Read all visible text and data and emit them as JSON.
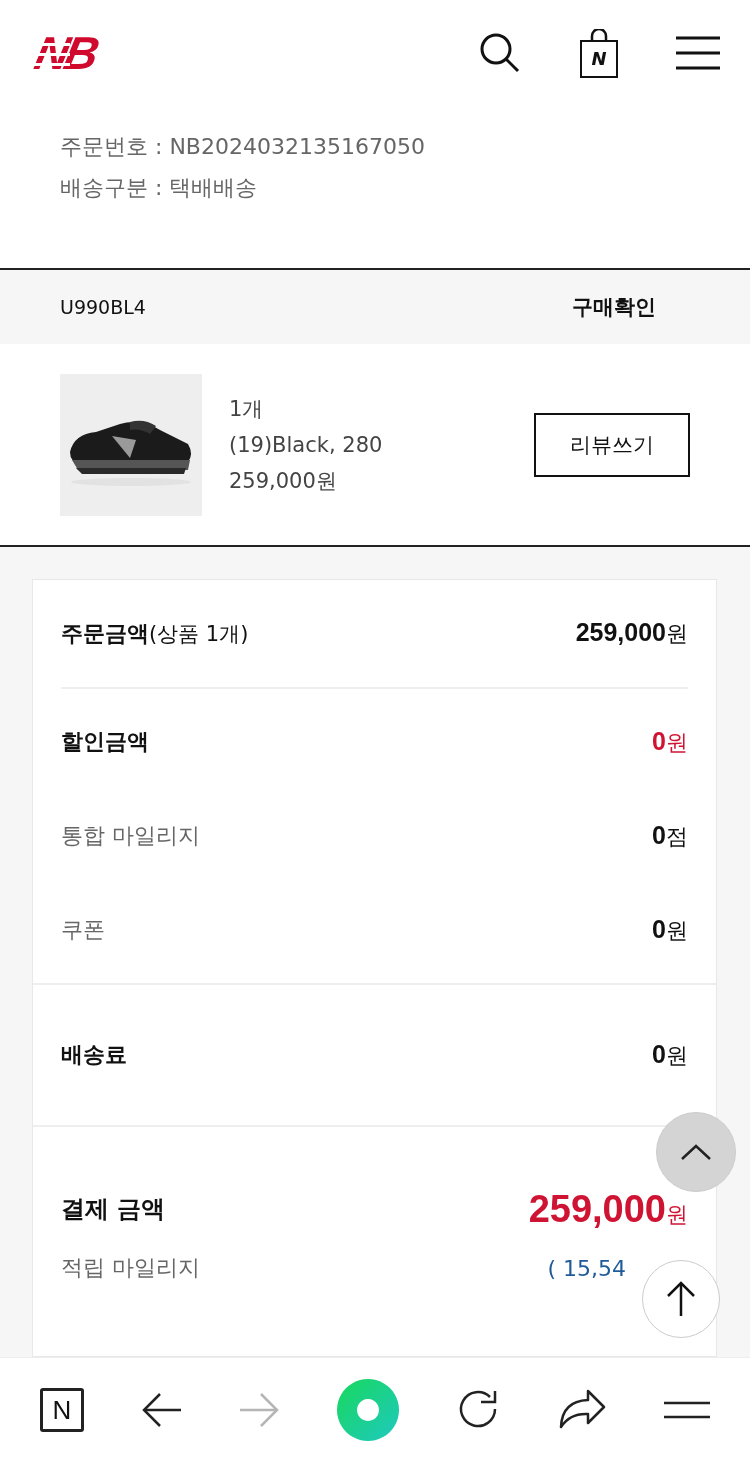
{
  "header": {
    "logo": "NB",
    "bag_label": "N"
  },
  "order_info": [
    "주문번호 : NB2024032135167050",
    "배송구분 : 택배배송"
  ],
  "product_header": {
    "code": "U990BL4",
    "status": "구매확인"
  },
  "product": {
    "kind": "picture",
    "quantity": "1개",
    "option": "(19)Black, 280",
    "price": "259,000원",
    "review_button": "리뷰쓰기"
  },
  "summary": [
    {
      "rows": [
        {
          "kind": "heading",
          "label": "주문금액",
          "note": "(상품 1개)",
          "amount": "259,000",
          "unit": "원",
          "highlight": false
        }
      ]
    },
    {
      "rows": [
        {
          "kind": "heading",
          "label": "할인금액",
          "amount": "0",
          "unit": "원",
          "highlight": true
        },
        {
          "kind": "sub",
          "label": "통합 마일리지",
          "amount": "0",
          "unit": "점",
          "highlight": false
        },
        {
          "kind": "sub",
          "label": "쿠폰",
          "amount": "0",
          "unit": "원",
          "highlight": false
        }
      ]
    },
    {
      "rows": [
        {
          "kind": "heading",
          "label": "배송료",
          "amount": "0",
          "unit": "원",
          "highlight": false
        }
      ]
    },
    {
      "rows": [
        {
          "kind": "total",
          "label": "결제 금액",
          "amount": "259,000",
          "unit": "원",
          "highlight": true
        },
        {
          "kind": "earn",
          "label": "적립 마일리지",
          "amount": "( 15,54",
          "highlight": false
        }
      ]
    }
  ],
  "browser_bar": {
    "home_label": "N",
    "forward_disabled": true
  }
}
